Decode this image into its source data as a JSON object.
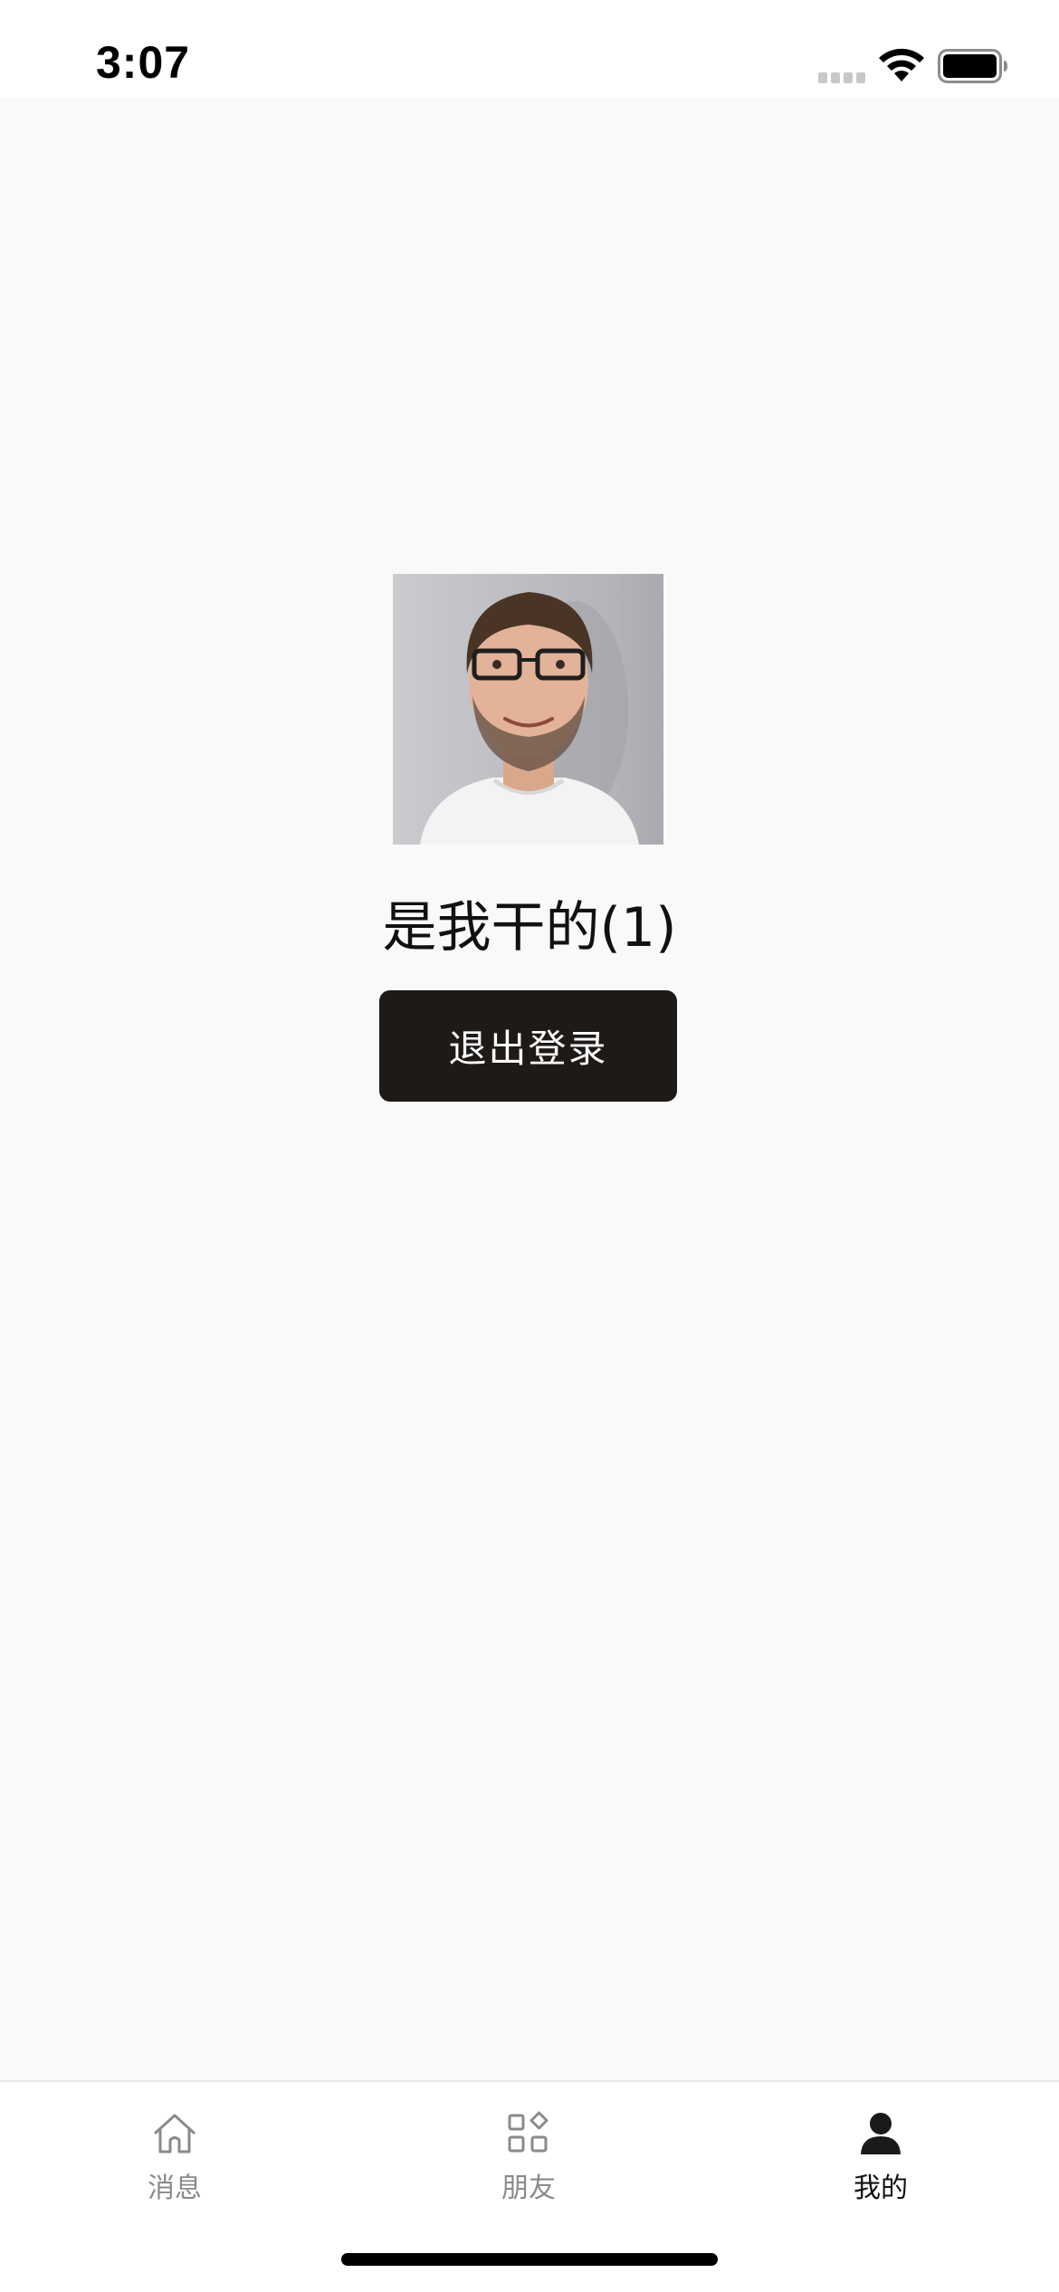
{
  "status_bar": {
    "time": "3:07",
    "icons": [
      "signal-icon",
      "wifi-icon",
      "battery-icon"
    ]
  },
  "profile": {
    "avatar": "avatar-photo",
    "username": "是我干的(1)",
    "logout_label": "退出登录"
  },
  "tab_bar": {
    "items": [
      {
        "label": "消息",
        "icon": "home-icon",
        "active": false
      },
      {
        "label": "朋友",
        "icon": "grid-icon",
        "active": false
      },
      {
        "label": "我的",
        "icon": "person-icon",
        "active": true
      }
    ]
  },
  "colors": {
    "background": "#f9f9f9",
    "button": "#1e1a18",
    "tab_active": "#111111",
    "tab_inactive": "#8a8a8a"
  }
}
